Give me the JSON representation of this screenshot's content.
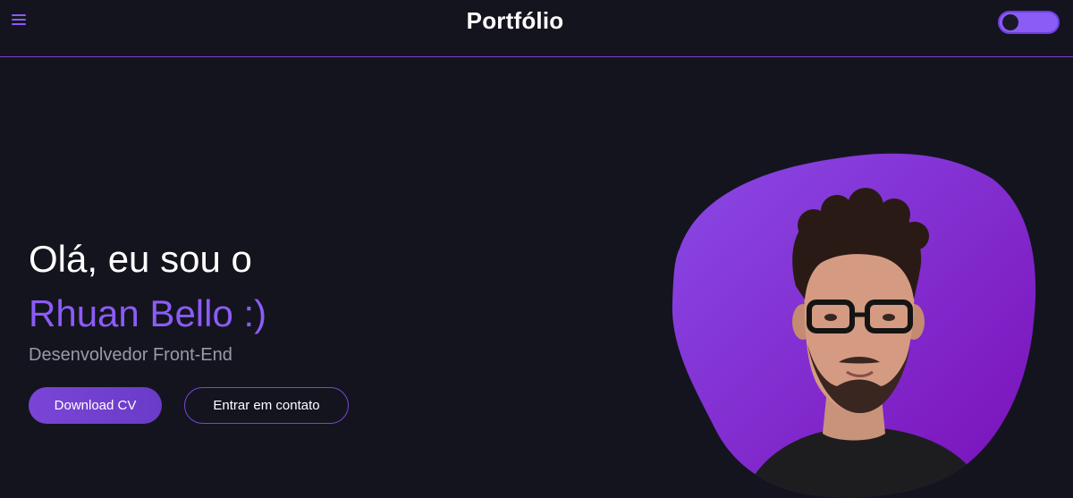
{
  "header": {
    "title": "Portfólio",
    "menu_icon": "hamburger-menu-icon",
    "theme_toggle_icon": "theme-toggle-icon"
  },
  "hero": {
    "greeting": "Olá, eu sou o",
    "name": "Rhuan Bello :)",
    "role": "Desenvolvedor Front-End",
    "primary_button": "Download CV",
    "secondary_button": "Entrar em contato"
  },
  "colors": {
    "background": "#14141f",
    "accent": "#8b5cf6",
    "blob_start": "#8a4ae6",
    "blob_end": "#7a0fb8",
    "muted_text": "#9a9aa6"
  }
}
